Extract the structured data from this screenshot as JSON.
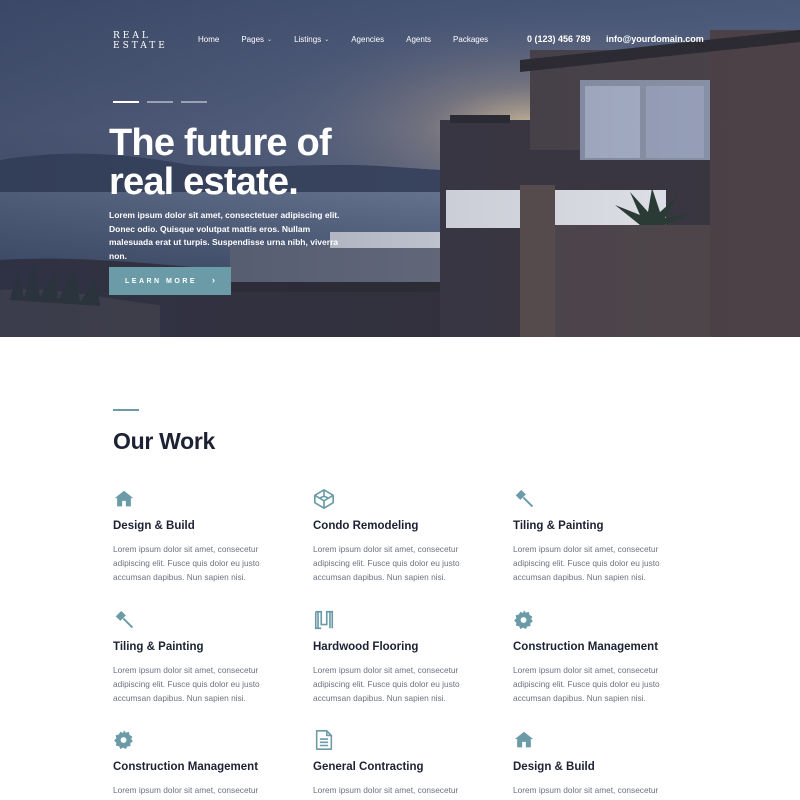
{
  "brand": {
    "logo_line1": "REAL",
    "logo_line2": "ESTATE"
  },
  "nav": {
    "items": [
      {
        "label": "Home"
      },
      {
        "label": "Pages",
        "dropdown": true
      },
      {
        "label": "Listings",
        "dropdown": true
      },
      {
        "label": "Agencies"
      },
      {
        "label": "Agents"
      },
      {
        "label": "Packages"
      }
    ],
    "phone": "0 (123) 456 789",
    "email": "info@yourdomain.com"
  },
  "hero": {
    "title_line1": "The future of",
    "title_line2": "real estate.",
    "description": "Lorem ipsum dolor sit amet, consectetuer adipiscing elit. Donec odio. Quisque volutpat mattis eros. Nullam malesuada erat ut turpis. Suspendisse urna nibh, viverra non.",
    "button_label": "LEARN MORE",
    "slides": 3,
    "active_slide": 1
  },
  "colors": {
    "accent": "#6c9ba8",
    "heading": "#1c2233",
    "body_text": "#6b7280"
  },
  "our_work": {
    "title": "Our Work",
    "cards": [
      {
        "icon": "home-icon",
        "title": "Design & Build",
        "text": "Lorem ipsum dolor sit amet, consecetur adipiscing elit. Fusce quis dolor eu justo accumsan dapibus. Nun sapien nisi."
      },
      {
        "icon": "cube-icon",
        "title": "Condo Remodeling",
        "text": "Lorem ipsum dolor sit amet, consecetur adipiscing elit. Fusce quis dolor eu justo accumsan dapibus. Nun sapien nisi."
      },
      {
        "icon": "hammer-icon",
        "title": "Tiling & Painting",
        "text": "Lorem ipsum dolor sit amet, consecetur adipiscing elit. Fusce quis dolor eu justo accumsan dapibus. Nun sapien nisi."
      },
      {
        "icon": "hammer-icon",
        "title": "Tiling & Painting",
        "text": "Lorem ipsum dolor sit amet, consecetur adipiscing elit. Fusce quis dolor eu justo accumsan dapibus. Nun sapien nisi."
      },
      {
        "icon": "flooring-icon",
        "title": "Hardwood Flooring",
        "text": "Lorem ipsum dolor sit amet, consecetur adipiscing elit. Fusce quis dolor eu justo accumsan dapibus. Nun sapien nisi."
      },
      {
        "icon": "gear-icon",
        "title": "Construction Management",
        "text": "Lorem ipsum dolor sit amet, consecetur adipiscing elit. Fusce quis dolor eu justo accumsan dapibus. Nun sapien nisi."
      },
      {
        "icon": "gear-icon",
        "title": "Construction Management",
        "text": "Lorem ipsum dolor sit amet, consecetur"
      },
      {
        "icon": "document-icon",
        "title": "General Contracting",
        "text": "Lorem ipsum dolor sit amet, consecetur"
      },
      {
        "icon": "home-icon",
        "title": "Design & Build",
        "text": "Lorem ipsum dolor sit amet, consecetur"
      }
    ]
  }
}
